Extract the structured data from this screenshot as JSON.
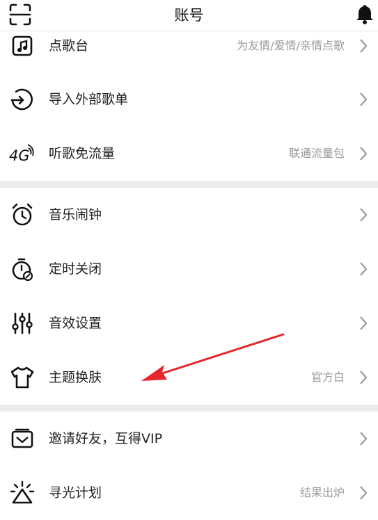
{
  "header": {
    "title": "账号",
    "left_icon": "scan-icon",
    "right_icon": "bell-icon"
  },
  "groups": [
    {
      "items": [
        {
          "label": "点歌台",
          "sub": "为友情/爱情/亲情点歌",
          "icon": "song-request-icon"
        },
        {
          "label": "导入外部歌单",
          "sub": "",
          "icon": "import-icon"
        },
        {
          "label": "听歌免流量",
          "sub": "联通流量包",
          "icon": "4g-icon"
        }
      ]
    },
    {
      "items": [
        {
          "label": "音乐闹钟",
          "sub": "",
          "icon": "alarm-clock-icon"
        },
        {
          "label": "定时关闭",
          "sub": "",
          "icon": "timer-icon"
        },
        {
          "label": "音效设置",
          "sub": "",
          "icon": "equalizer-icon"
        },
        {
          "label": "主题换肤",
          "sub": "官方白",
          "icon": "tshirt-icon"
        }
      ]
    },
    {
      "items": [
        {
          "label": "邀请好友，互得VIP",
          "sub": "",
          "icon": "invite-icon"
        },
        {
          "label": "寻光计划",
          "sub": "结果出炉",
          "icon": "sparkle-icon"
        }
      ]
    }
  ],
  "colors": {
    "annotation_arrow": "#e8262b",
    "separator_band": "#ececec",
    "secondary_text": "#9a9a9a"
  }
}
